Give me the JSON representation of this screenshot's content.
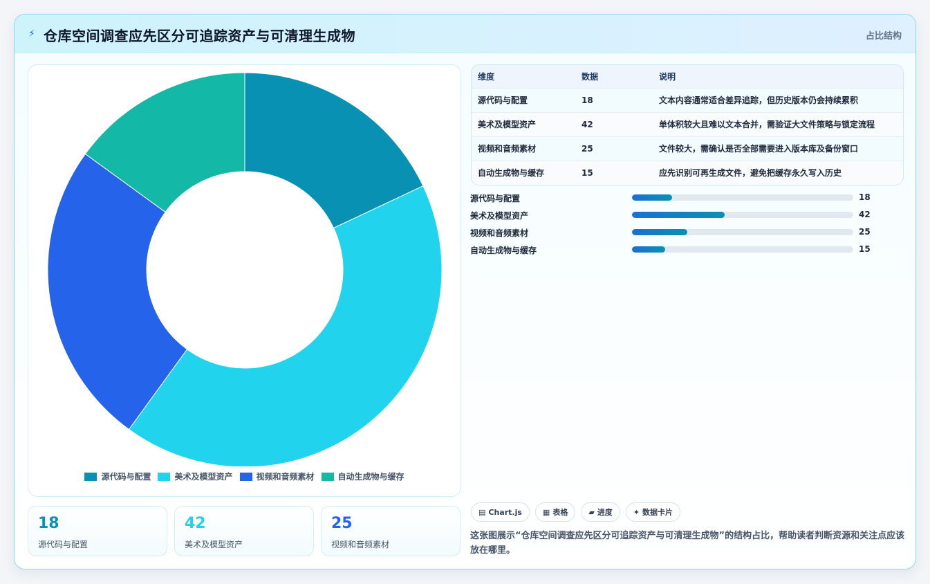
{
  "header": {
    "icon": "lightning-icon",
    "title": "仓库空间调查应先区分可追踪资产与可清理生成物",
    "tag": "占比结构"
  },
  "chart_data": {
    "type": "pie",
    "donut": true,
    "categories": [
      "源代码与配置",
      "美术及模型资产",
      "视频和音频素材",
      "自动生成物与缓存"
    ],
    "values": [
      18,
      42,
      25,
      15
    ],
    "colors": [
      "#0891b2",
      "#22d3ee",
      "#2563eb",
      "#14b8a6"
    ],
    "legend_position": "bottom"
  },
  "stats": [
    {
      "value": "18",
      "label": "源代码与配置",
      "color": "#0891b2"
    },
    {
      "value": "42",
      "label": "美术及模型资产",
      "color": "#22d3ee"
    },
    {
      "value": "25",
      "label": "视频和音频素材",
      "color": "#2563eb"
    }
  ],
  "table": {
    "headers": [
      "维度",
      "数据",
      "说明"
    ],
    "rows": [
      {
        "dim": "源代码与配置",
        "val": "18",
        "desc": "文本内容通常适合差异追踪，但历史版本仍会持续累积"
      },
      {
        "dim": "美术及模型资产",
        "val": "42",
        "desc": "单体积较大且难以文本合并，需验证大文件策略与锁定流程"
      },
      {
        "dim": "视频和音频素材",
        "val": "25",
        "desc": "文件较大，需确认是否全部需要进入版本库及备份窗口"
      },
      {
        "dim": "自动生成物与缓存",
        "val": "15",
        "desc": "应先识别可再生成文件，避免把缓存永久写入历史"
      }
    ]
  },
  "progress": {
    "max": 100,
    "items": [
      {
        "label": "源代码与配置",
        "value": 18
      },
      {
        "label": "美术及模型资产",
        "value": 42
      },
      {
        "label": "视频和音频素材",
        "value": 25
      },
      {
        "label": "自动生成物与缓存",
        "value": 15
      }
    ]
  },
  "chips": [
    {
      "icon": "chart-icon",
      "glyph": "▤",
      "label": "Chart.js"
    },
    {
      "icon": "table-icon",
      "glyph": "▦",
      "label": "表格"
    },
    {
      "icon": "progress-icon",
      "glyph": "▰",
      "label": "进度"
    },
    {
      "icon": "card-icon",
      "glyph": "✦",
      "label": "数据卡片"
    }
  ],
  "note": "这张图展示“仓库空间调查应先区分可追踪资产与可清理生成物”的结构占比，帮助读者判断资源和关注点应该放在哪里。"
}
